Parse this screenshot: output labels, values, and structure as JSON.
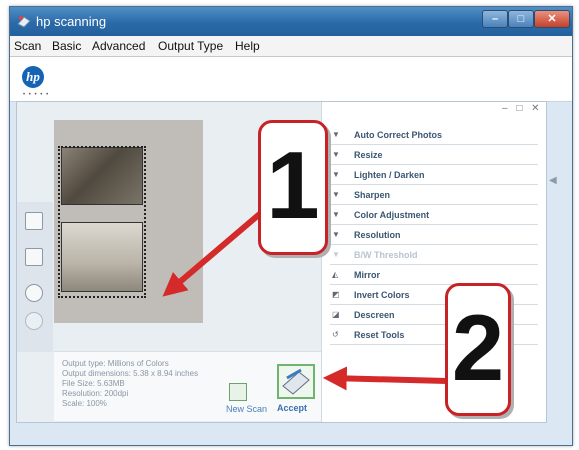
{
  "window": {
    "title": "hp scanning",
    "controls": {
      "minimize": "–",
      "maximize": "□",
      "close": "✕"
    }
  },
  "menu": [
    "Scan",
    "Basic",
    "Advanced",
    "Output Type",
    "Help"
  ],
  "logo": {
    "text": "hp",
    "dots": "• • • • •"
  },
  "preview": {
    "output_type": "Output type: Millions of Colors",
    "output_dimensions": "Output dimensions: 5.38 x 8.94 inches",
    "file_size": "File Size: 5.63MB",
    "resolution": "Resolution:  200dpi",
    "scale": "Scale: 100%",
    "new_scan_label": "New Scan",
    "accept_label": "Accept"
  },
  "tools_panel": {
    "controls": "– □ ✕",
    "items": [
      {
        "label": "Auto Correct Photos",
        "icon": "chevron-down-icon",
        "enabled": true
      },
      {
        "label": "Resize",
        "icon": "chevron-down-icon",
        "enabled": true
      },
      {
        "label": "Lighten / Darken",
        "icon": "chevron-down-icon",
        "enabled": true
      },
      {
        "label": "Sharpen",
        "icon": "chevron-down-icon",
        "enabled": true
      },
      {
        "label": "Color Adjustment",
        "icon": "chevron-down-icon",
        "enabled": true
      },
      {
        "label": "Resolution",
        "icon": "chevron-down-icon",
        "enabled": true
      },
      {
        "label": "B/W Threshold",
        "icon": "chevron-down-icon",
        "enabled": false
      },
      {
        "label": "Mirror",
        "icon": "mirror-icon",
        "enabled": true
      },
      {
        "label": "Invert Colors",
        "icon": "invert-icon",
        "enabled": true
      },
      {
        "label": "Descreen",
        "icon": "descreen-icon",
        "enabled": true
      },
      {
        "label": "Reset Tools",
        "icon": "reset-icon",
        "enabled": true
      }
    ]
  },
  "callouts": {
    "one": "1",
    "two": "2"
  },
  "colors": {
    "callout_border": "#c72327",
    "titlebar": "#2b6aa9",
    "accept_border": "#6fb46f"
  }
}
